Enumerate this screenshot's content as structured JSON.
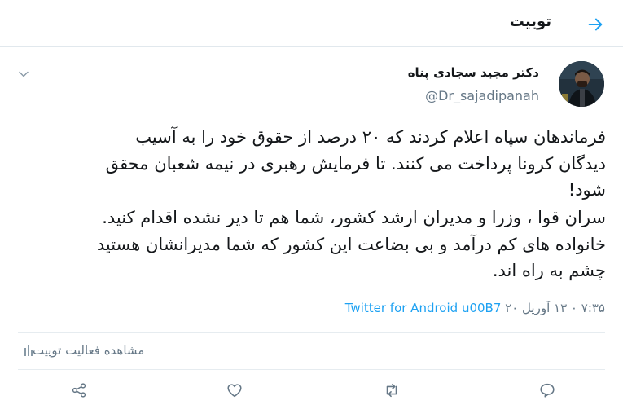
{
  "header": {
    "title": "توییت",
    "back_icon": "arrow-right-icon"
  },
  "tweet": {
    "author_name": "دکتر مجید سجادی پناه",
    "handle": "@Dr_sajadipanah",
    "lines": [
      "فرماندهان سپاه اعلام کردند که ۲۰ درصد از حقوق خود را به آسیب",
      "دیدگان کرونا پرداخت می کنند. تا فرمایش رهبری در نیمه شعبان محقق",
      "شود!",
      "سران قوا ، وزرا و مدیران ارشد کشور، شما هم تا دیر نشده اقدام کنید.",
      "خانواده های کم درآمد و بی بضاعت این کشور که شما مدیرانشان هستید",
      "چشم به راه اند."
    ],
    "meta_time_date": "۷:۳۵ ۰ ۱۳ آوریل ۲۰",
    "meta_source": "Twitter for Android u00B7"
  },
  "activity_label": "مشاهده فعالیت توییت",
  "icons": {
    "caret": "chevron-down-icon",
    "activity": "bar-chart-icon",
    "reply": "reply-icon",
    "retweet": "retweet-icon",
    "like": "heart-icon",
    "share": "share-icon"
  },
  "colors": {
    "accent": "#1da1f2",
    "text_primary": "#14171a",
    "text_secondary": "#657786",
    "divider": "#e6ecf0"
  }
}
